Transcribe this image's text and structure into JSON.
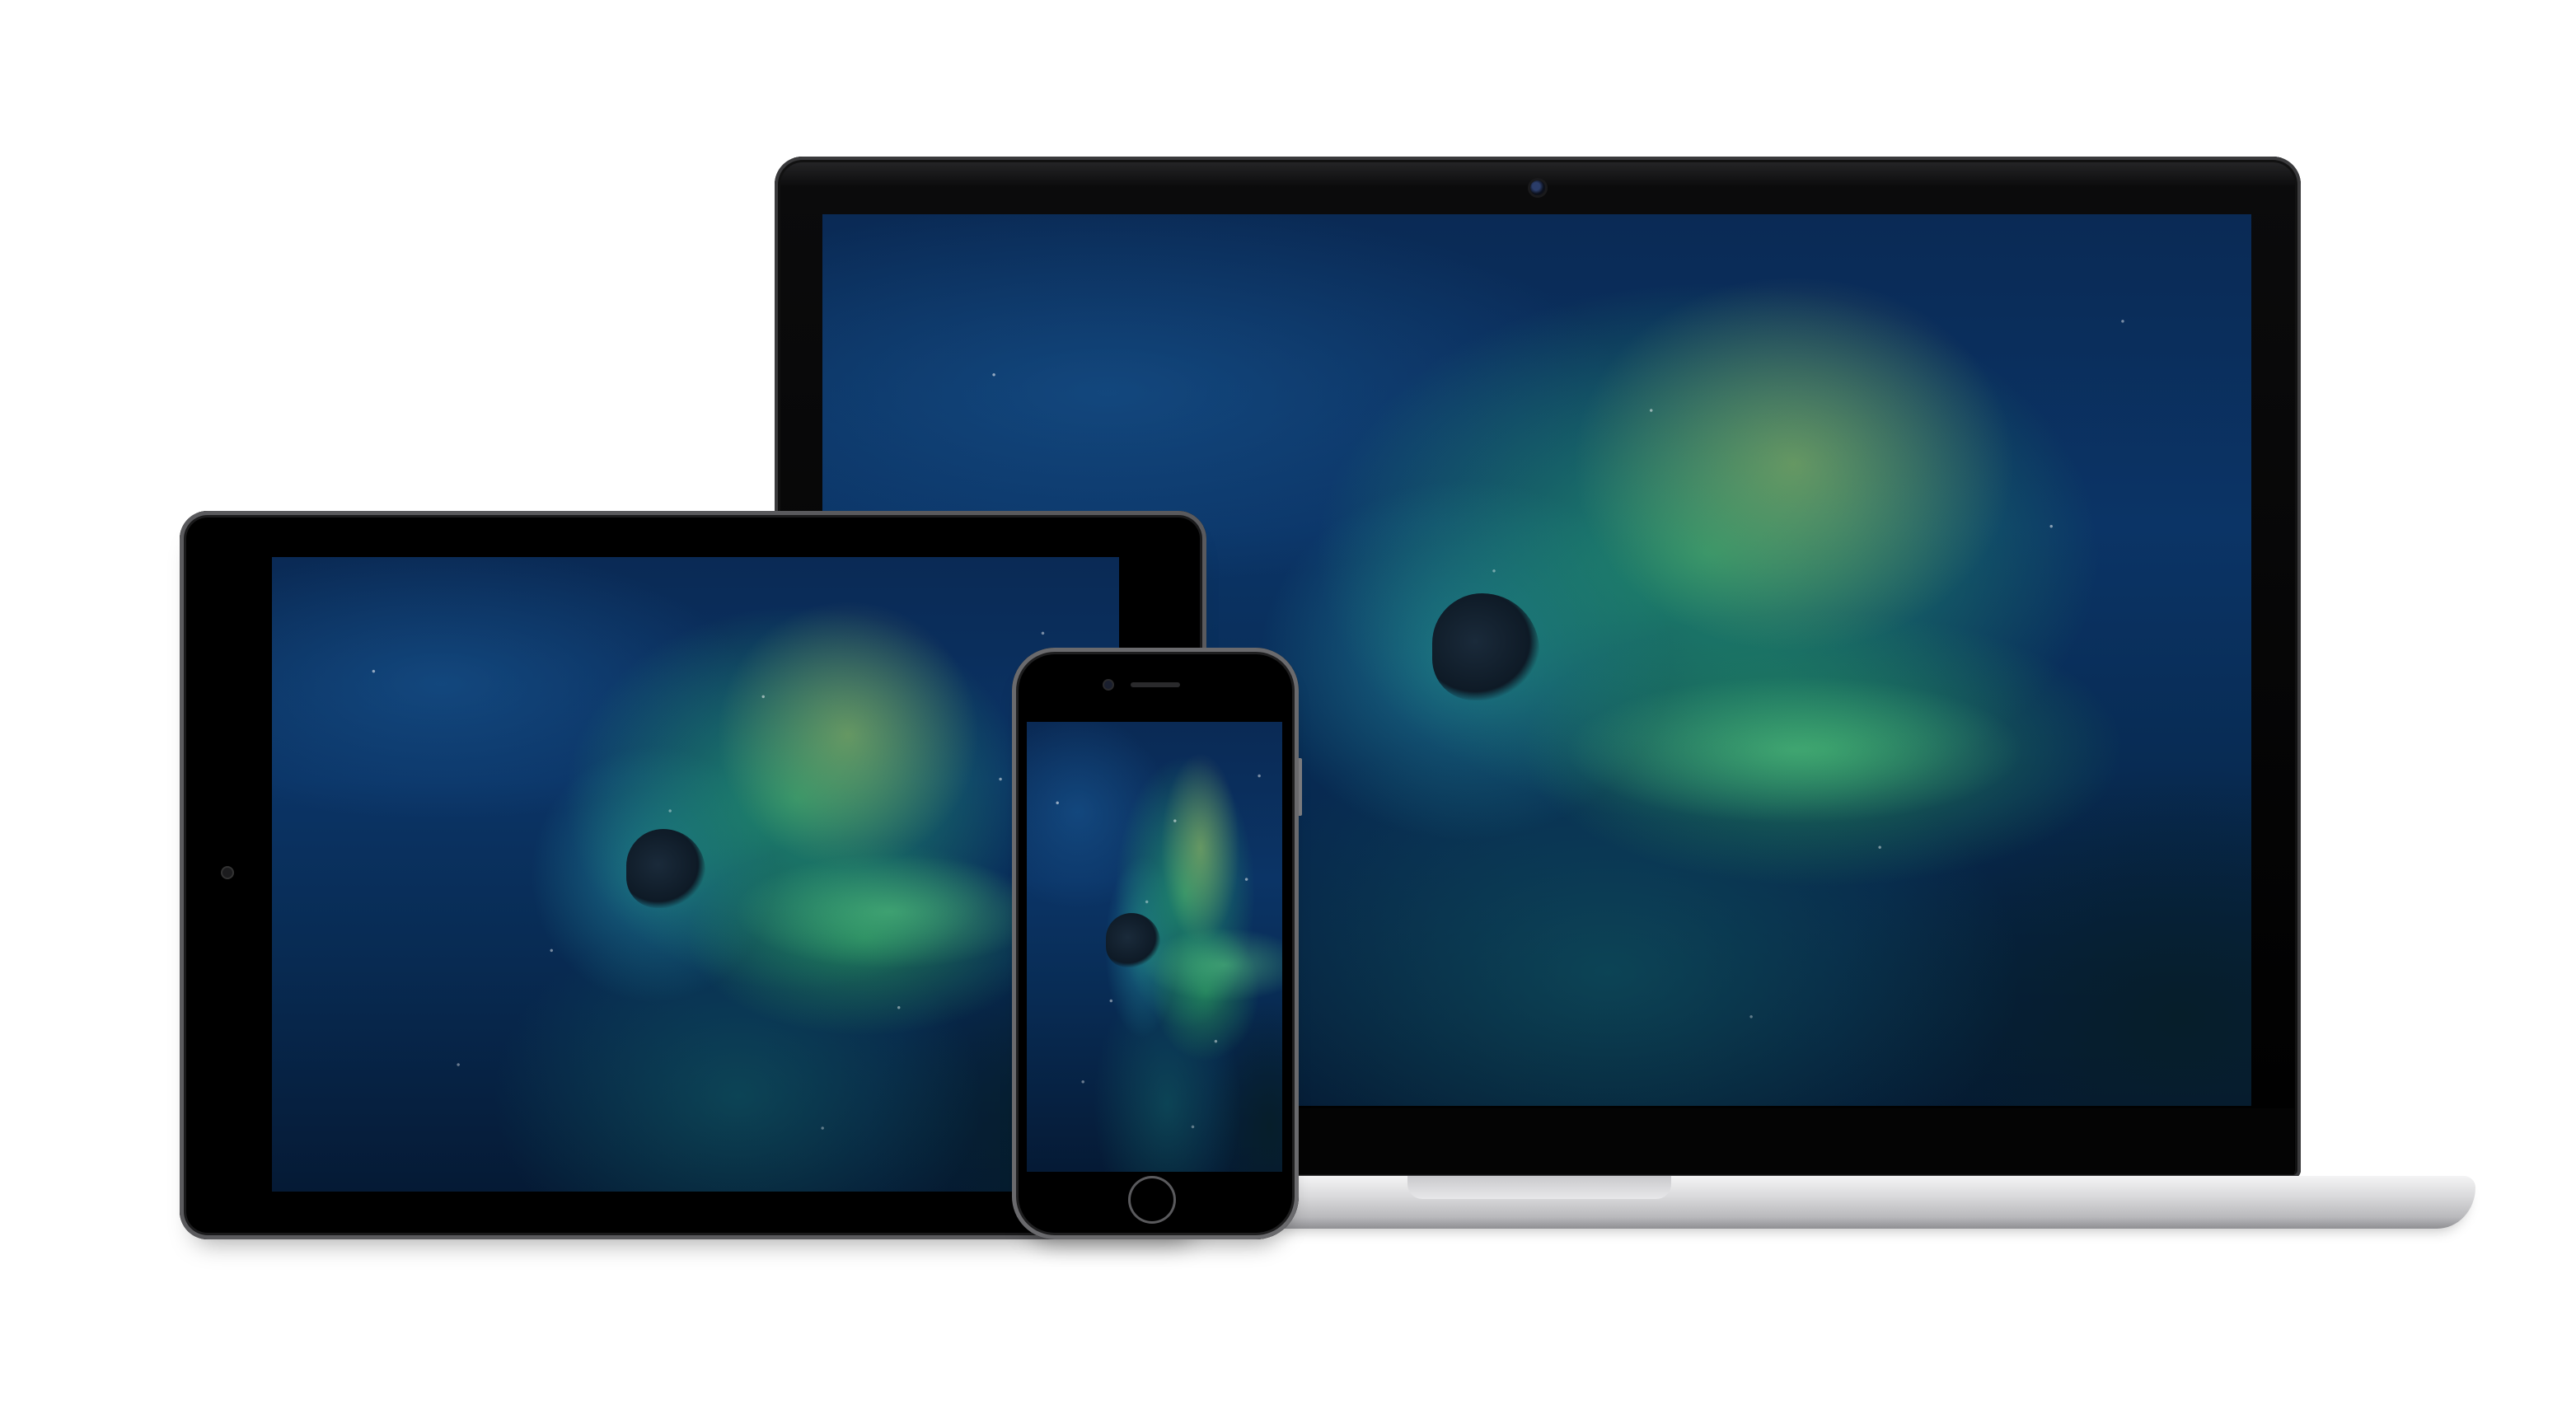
{
  "scene": {
    "background": "#ffffff",
    "devices": [
      "laptop",
      "tablet",
      "phone"
    ],
    "wallpaper": "nebula",
    "colors": {
      "nebula_deep": "#082c55",
      "nebula_green": "#28aa6e",
      "nebula_teal": "#28a0aa",
      "device_frame": "#000000",
      "laptop_aluminum": "#d9d9db"
    },
    "icons": {
      "laptop": "laptop-icon",
      "tablet": "tablet-icon",
      "phone": "phone-icon"
    }
  }
}
